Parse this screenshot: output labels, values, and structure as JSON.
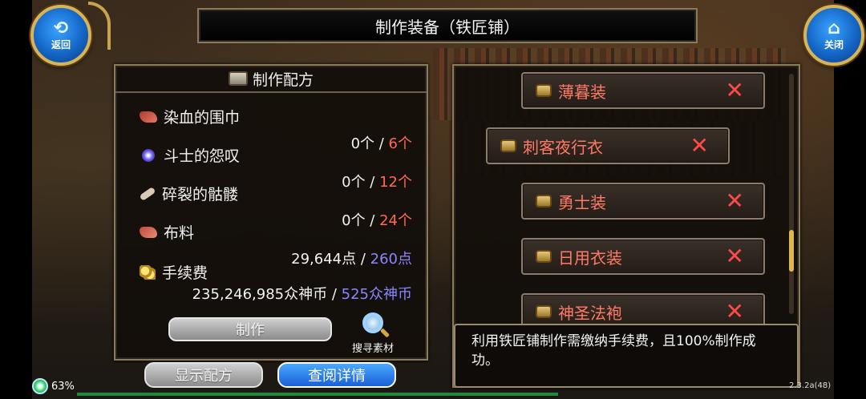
{
  "window": {
    "title": "制作装备（铁匠铺）"
  },
  "nav": {
    "back_label": "返回",
    "close_label": "关闭"
  },
  "recipe": {
    "header": "制作配方",
    "materials": [
      {
        "name": "染血的围巾",
        "have": "0个",
        "sep": " / ",
        "need": "6个",
        "icon": "scarf-icon"
      },
      {
        "name": "斗士的怨叹",
        "have": "0个",
        "sep": " / ",
        "need": "12个",
        "icon": "orb-icon"
      },
      {
        "name": "碎裂的骷髅",
        "have": "0个",
        "sep": " / ",
        "need": "24个",
        "icon": "bone-icon"
      },
      {
        "name": "布料",
        "have": "29,644点",
        "sep": " / ",
        "need": "260点",
        "icon": "cloth-icon"
      }
    ],
    "fee": {
      "name": "手续费",
      "have": "235,246,985众神币",
      "sep": " / ",
      "need": "525众神币",
      "icon": "coins-icon"
    },
    "make_label": "制作",
    "search_label": "搜寻素材"
  },
  "bottom": {
    "show_recipe_label": "显示配方",
    "view_detail_label": "查阅详情"
  },
  "equipment_list": [
    {
      "name": "薄暮装"
    },
    {
      "name": "刺客夜行衣"
    },
    {
      "name": "勇士装"
    },
    {
      "name": "日用衣装"
    },
    {
      "name": "神圣法袍"
    }
  ],
  "description": "利用铁匠铺制作需缴纳手续费，且100%制作成功。",
  "status": {
    "battery": "63%",
    "version": "2.3.2a(48)"
  },
  "colors": {
    "need_red": "#ff6a4d",
    "need_blue": "#8b86ff",
    "item_text": "#ff7a66",
    "accent_blue": "#1a5fd6"
  }
}
